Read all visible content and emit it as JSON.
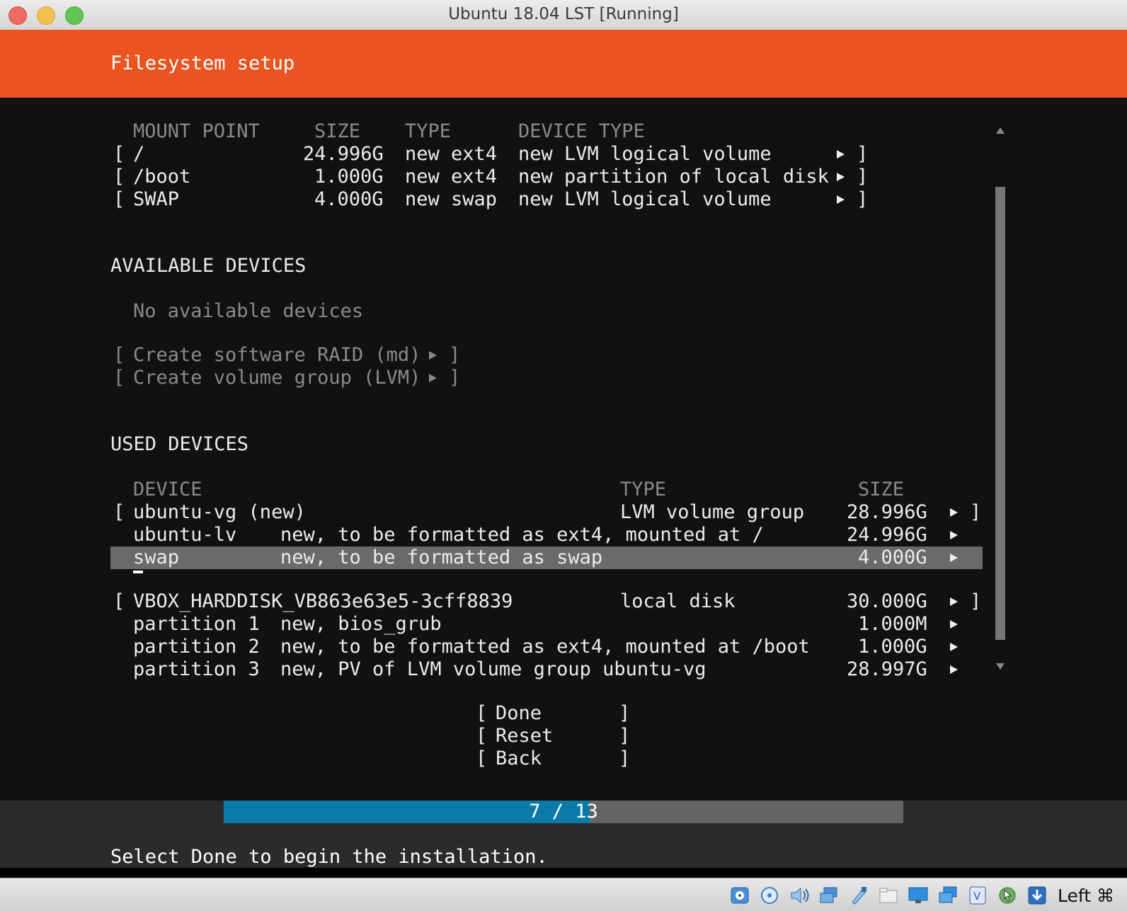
{
  "window": {
    "title": "Ubuntu 18.04 LST [Running]",
    "traffic_lights": [
      "#ED6A5E",
      "#F4BF4F",
      "#61C554"
    ]
  },
  "header": {
    "title": "Filesystem setup",
    "color": "#E95420"
  },
  "filesystem_summary": {
    "columns": [
      "MOUNT POINT",
      "SIZE",
      "TYPE",
      "DEVICE TYPE"
    ],
    "rows": [
      {
        "open": "[",
        "mount": "/",
        "size": "24.996G",
        "type": "new ext4",
        "device_type": "new LVM logical volume",
        "close": "]"
      },
      {
        "open": "[",
        "mount": "/boot",
        "size": "1.000G",
        "type": "new ext4",
        "device_type": "new partition of local disk",
        "close": "]"
      },
      {
        "open": "[",
        "mount": "SWAP",
        "size": "4.000G",
        "type": "new swap",
        "device_type": "new LVM logical volume",
        "close": "]"
      }
    ]
  },
  "available_devices": {
    "heading": "AVAILABLE DEVICES",
    "empty_message": "No available devices",
    "actions": [
      {
        "open": "[",
        "label": "Create software RAID (md)",
        "close": "]"
      },
      {
        "open": "[",
        "label": "Create volume group (LVM)",
        "close": "]"
      }
    ]
  },
  "used_devices": {
    "heading": "USED DEVICES",
    "columns": [
      "DEVICE",
      "TYPE",
      "SIZE"
    ],
    "groups": [
      {
        "open": "[",
        "close": "]",
        "device": "ubuntu-vg (new)",
        "type": "LVM volume group",
        "size": "28.996G",
        "children": [
          {
            "name": "ubuntu-lv",
            "desc": "new, to be formatted as ext4, mounted at /",
            "size": "24.996G",
            "selected": false
          },
          {
            "name": "swap",
            "desc": "new, to be formatted as swap",
            "size": "4.000G",
            "selected": true
          }
        ]
      },
      {
        "open": "[",
        "close": "]",
        "device": "VBOX_HARDDISK_VB863e63e5-3cff8839",
        "type": "local disk",
        "size": "30.000G",
        "children": [
          {
            "name": "partition 1",
            "desc": "new, bios_grub",
            "size": "1.000M",
            "selected": false
          },
          {
            "name": "partition 2",
            "desc": "new, to be formatted as ext4, mounted at /boot",
            "size": "1.000G",
            "selected": false
          },
          {
            "name": "partition 3",
            "desc": "new, PV of LVM volume group ubuntu-vg",
            "size": "28.997G",
            "selected": false
          }
        ]
      }
    ]
  },
  "buttons": {
    "open": "[",
    "close": "]",
    "done": "Done",
    "reset": "Reset",
    "back": "Back"
  },
  "progress": {
    "text": "7 / 13",
    "current": 7,
    "total": 13,
    "color": "#0C7AA8"
  },
  "status": "Select Done to begin the installation.",
  "vm_statusbar": {
    "icons": [
      "hard-disk-icon",
      "optical-drive-icon",
      "audio-icon",
      "network-icon",
      "usb-icon",
      "shared-folder-icon",
      "display-icon",
      "recording-icon",
      "vrde-icon",
      "mouse-integration-icon",
      "keyboard-capture-icon"
    ],
    "host_key": "Left ⌘"
  }
}
